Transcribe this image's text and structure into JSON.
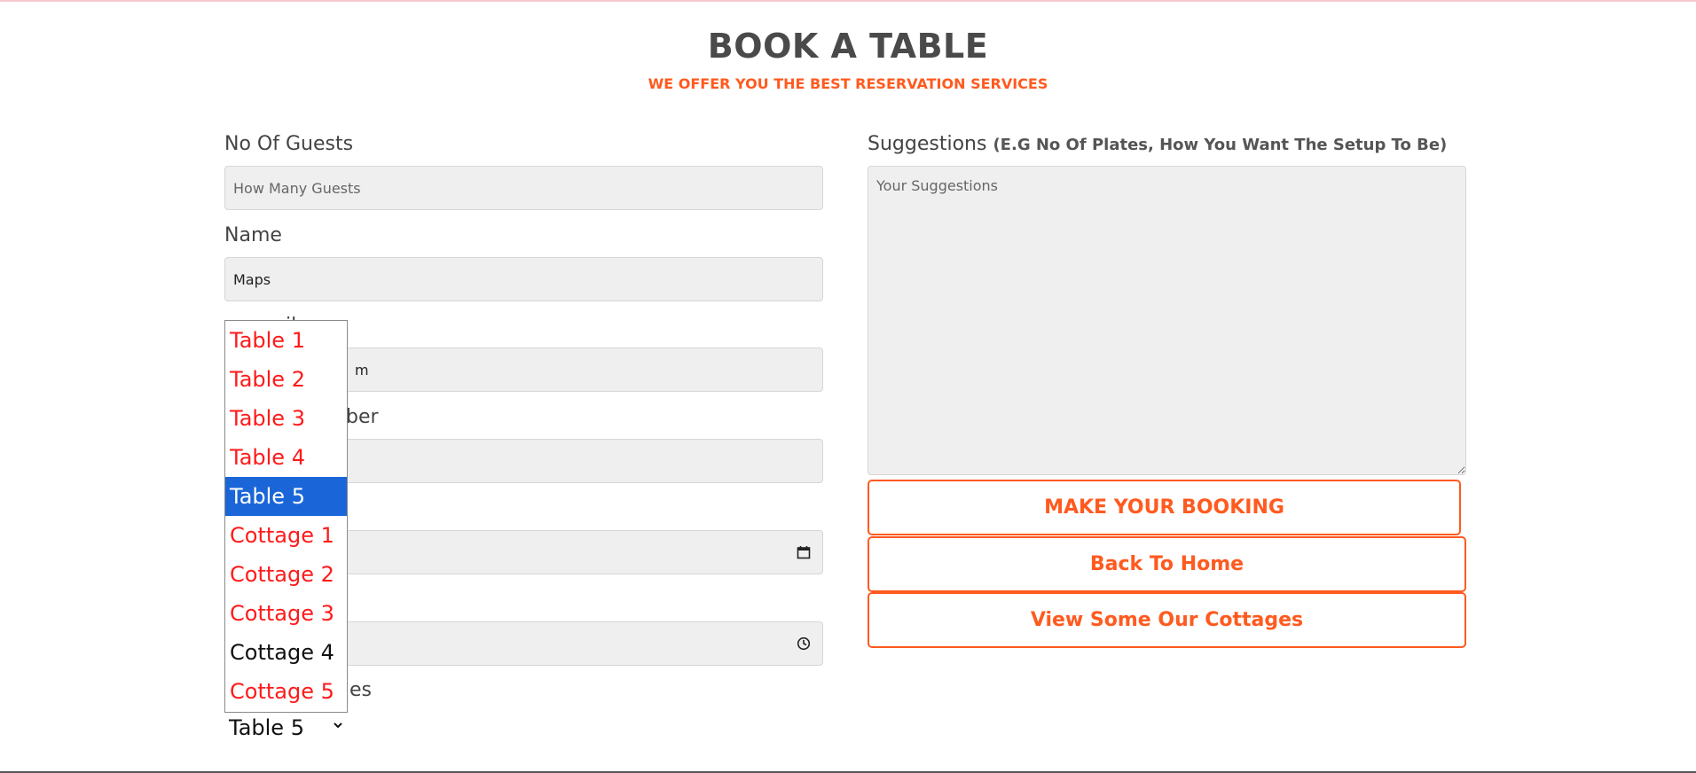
{
  "header": {
    "title": "BOOK A TABLE",
    "subtitle": "WE OFFER YOU THE BEST RESERVATION SERVICES"
  },
  "form": {
    "guests": {
      "label": "No Of Guests",
      "placeholder": "How Many Guests",
      "value": ""
    },
    "name": {
      "label": "Name",
      "value": "Maps"
    },
    "email": {
      "label_visible": "il",
      "value_visible": "m"
    },
    "phone": {
      "label_visible": "ber",
      "value": ""
    },
    "date": {
      "value": ""
    },
    "time": {
      "value": ""
    },
    "table": {
      "label_visible": "ges",
      "selected": "Table 5",
      "options": [
        {
          "label": "Table 1",
          "color": "#ff1a1a"
        },
        {
          "label": "Table 2",
          "color": "#ff1a1a"
        },
        {
          "label": "Table 3",
          "color": "#ff1a1a"
        },
        {
          "label": "Table 4",
          "color": "#ff1a1a"
        },
        {
          "label": "Table 5",
          "color": "#ffffff"
        },
        {
          "label": "Cottage 1",
          "color": "#ff1a1a"
        },
        {
          "label": "Cottage 2",
          "color": "#ff1a1a"
        },
        {
          "label": "Cottage 3",
          "color": "#ff1a1a"
        },
        {
          "label": "Cottage 4",
          "color": "#111111"
        },
        {
          "label": "Cottage 5",
          "color": "#ff1a1a"
        }
      ],
      "highlighted_index": 4
    },
    "suggestions": {
      "label": "Suggestions",
      "hint": "(E.G No Of Plates, How You Want The Setup To Be)",
      "placeholder": "Your Suggestions"
    }
  },
  "buttons": {
    "booking": "MAKE YOUR BOOKING",
    "home": "Back To Home",
    "cottages": "View Some Our Cottages"
  },
  "icons": {
    "date": "calendar-icon",
    "time": "clock-icon",
    "select": "chevron-down-icon"
  },
  "colors": {
    "accent": "#ff5a1f",
    "option_red": "#ff1a1a",
    "selected_bg": "#1a66d8",
    "field_bg": "#efefef"
  }
}
